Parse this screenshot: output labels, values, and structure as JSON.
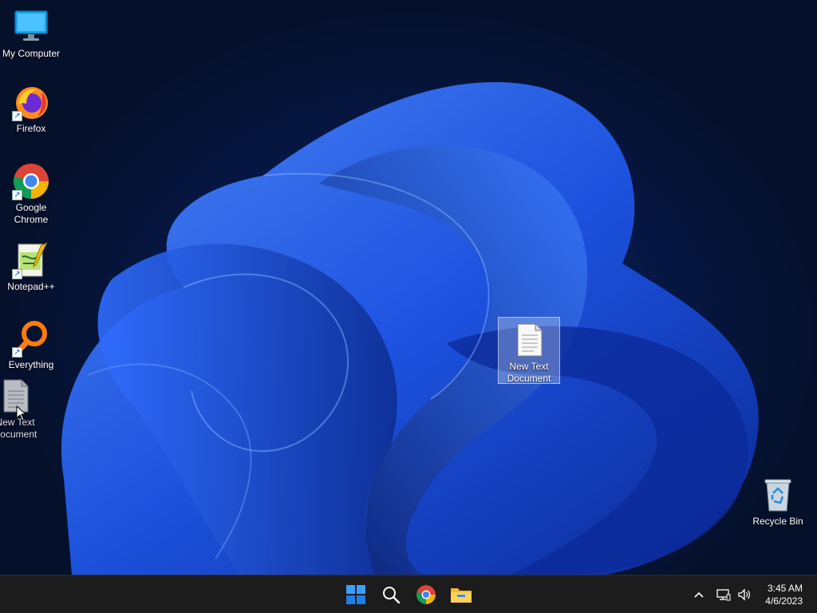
{
  "desktop": {
    "icons": [
      {
        "label": "My Computer",
        "icon": "monitor-icon"
      },
      {
        "label": "Firefox",
        "icon": "firefox-icon"
      },
      {
        "label": "Google Chrome",
        "icon": "chrome-icon"
      },
      {
        "label": "Notepad++",
        "icon": "notepadpp-icon"
      },
      {
        "label": "Everything",
        "icon": "everything-icon"
      },
      {
        "label": "New Text Document",
        "icon": "text-document-icon"
      },
      {
        "label": "New Text Document",
        "icon": "text-document-icon"
      },
      {
        "label": "Recycle Bin",
        "icon": "recycle-bin-icon"
      }
    ]
  },
  "taskbar": {
    "pinned": [
      "windows-start-icon",
      "search-icon",
      "chrome-icon",
      "file-explorer-icon"
    ],
    "tray": [
      "chevron-up-icon",
      "network-icon",
      "volume-icon"
    ],
    "clock": {
      "time": "3:45 AM",
      "date": "4/6/2023"
    }
  },
  "colors": {
    "taskbar": "#1c1c1c",
    "accent": "#1f6fe0"
  }
}
